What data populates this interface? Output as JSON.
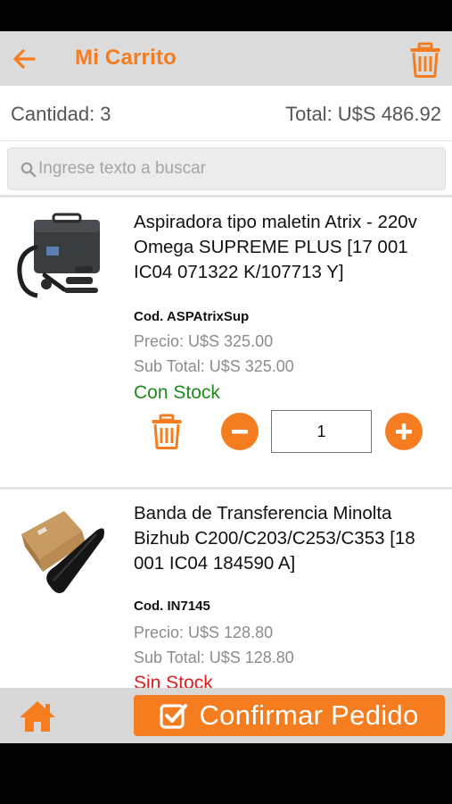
{
  "header": {
    "title": "Mi Carrito",
    "back_icon": "arrow-left-icon",
    "trash_icon": "trash-icon"
  },
  "summary": {
    "quantity": "Cantidad: 3",
    "total": "Total: U$S 486.92"
  },
  "search": {
    "placeholder": "Ingrese texto a buscar",
    "value": ""
  },
  "items": [
    {
      "name": "Aspiradora tipo maletin Atrix - 220v Omega SUPREME PLUS [17 001 IC04 071322 K/107713 Y]",
      "code": "Cod. ASPAtrixSup",
      "price": "Precio: U$S 325.00",
      "subtotal": "Sub Total: U$S 325.00",
      "stock": "Con Stock",
      "quantity": "1"
    },
    {
      "name": "Banda de Transferencia Minolta Bizhub C200/C203/C253/C353 [18 001 IC04 184590 A]",
      "code": "Cod. IN7145",
      "price": "Precio: U$S 128.80",
      "subtotal": "Sub Total: U$S 128.80",
      "stock": "Sin Stock",
      "quantity": ""
    }
  ],
  "footer": {
    "confirm_label": "Confirmar Pedido",
    "home_icon": "home-icon",
    "confirm_icon": "checkbox-icon"
  },
  "colors": {
    "accent": "#f57c1f",
    "in_stock": "#1c8a1c",
    "out_of_stock": "#e31b1b"
  }
}
